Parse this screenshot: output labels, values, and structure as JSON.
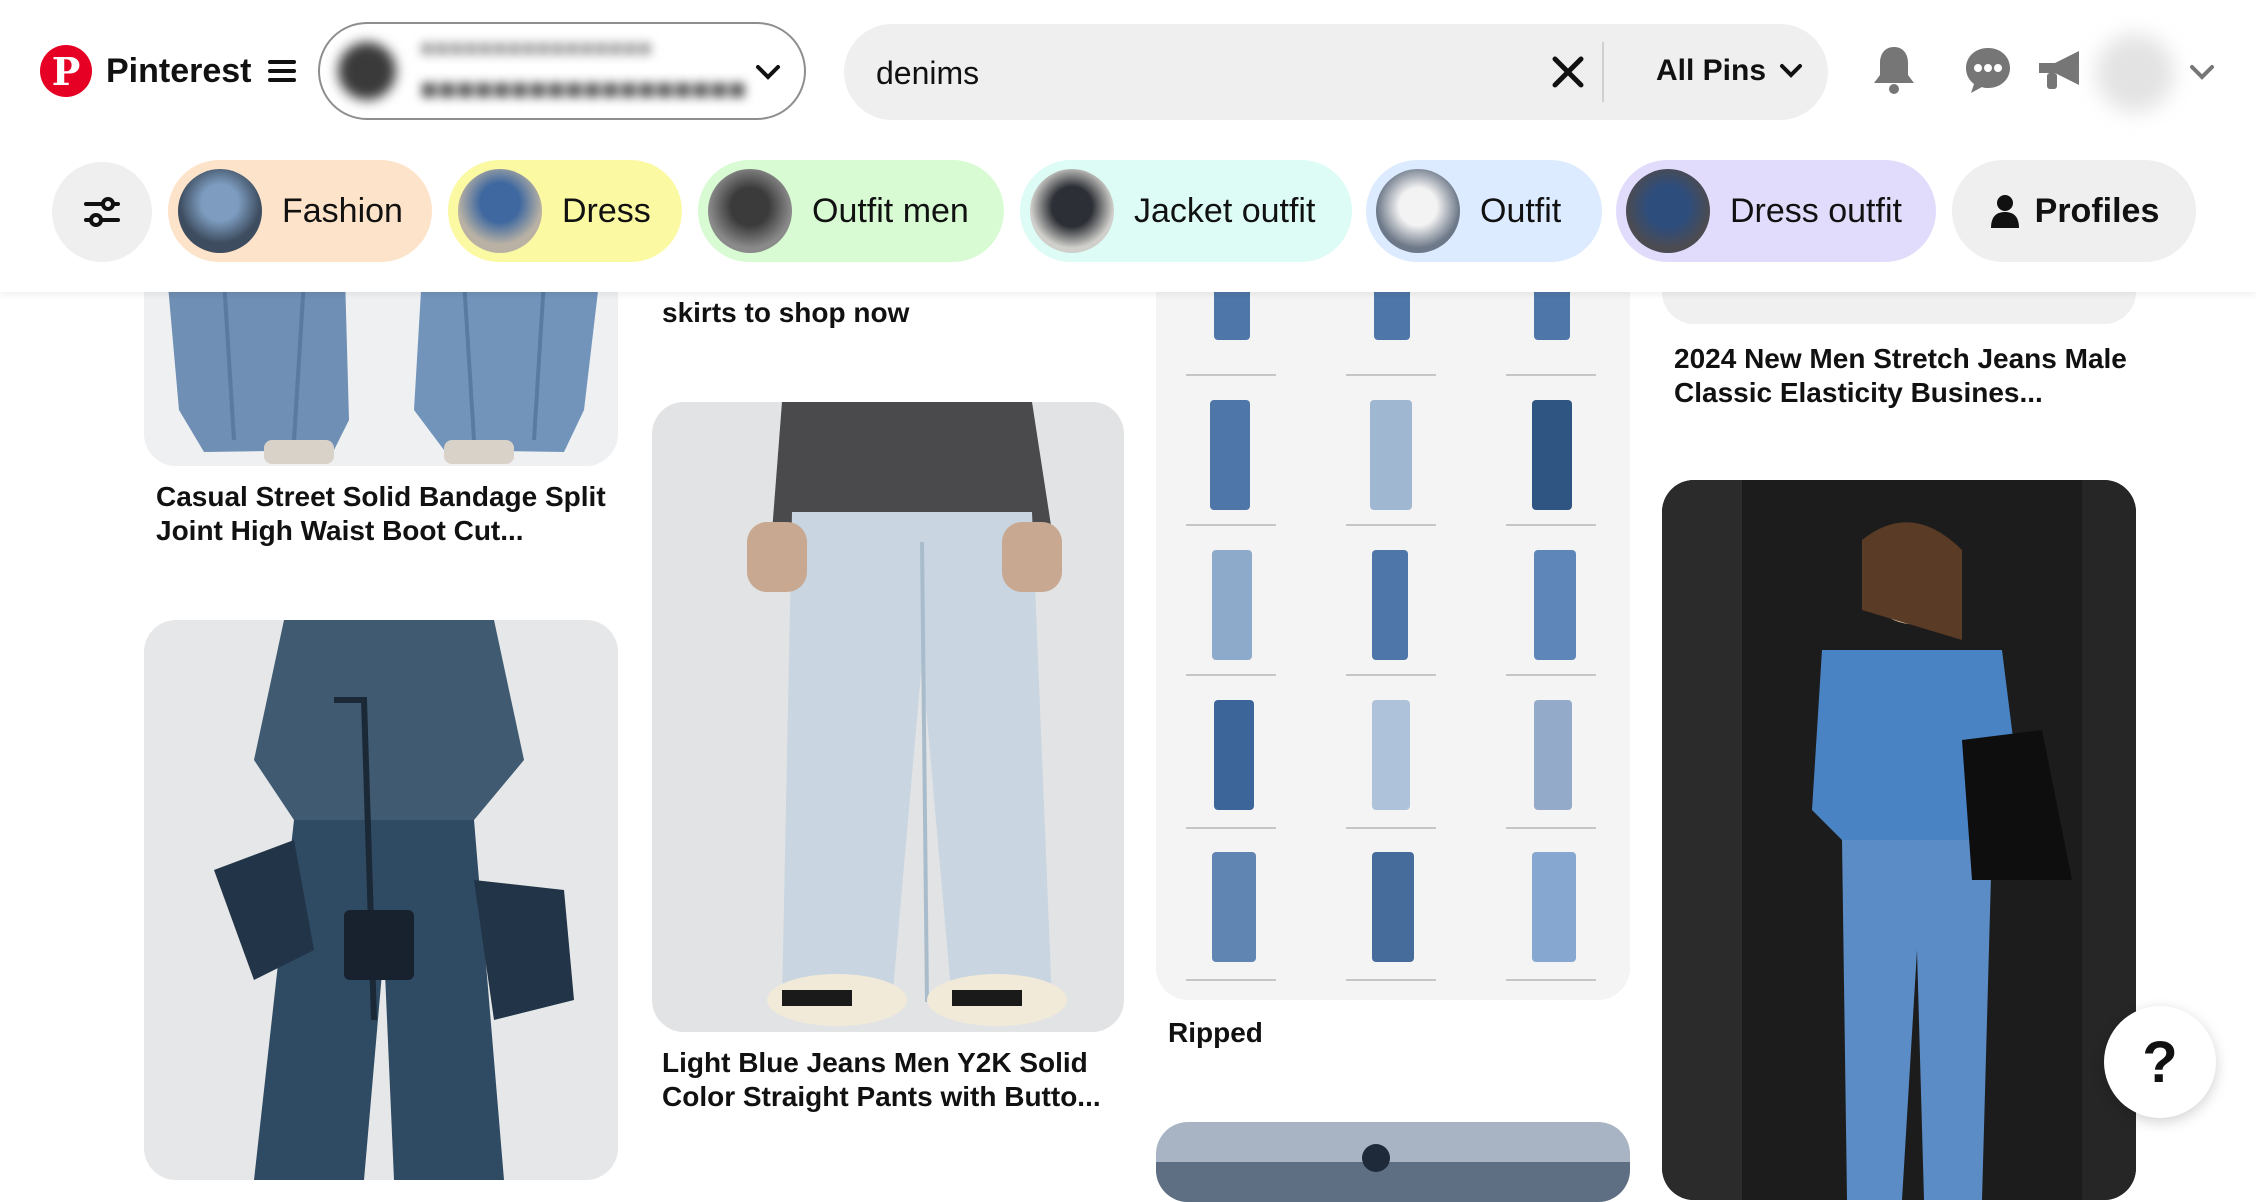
{
  "brand": {
    "name": "Pinterest"
  },
  "search": {
    "value": "denims",
    "scope": "All Pins"
  },
  "chips": [
    {
      "label": "Fashion",
      "color": "#fde3c9"
    },
    {
      "label": "Dress",
      "color": "#fcf9a3"
    },
    {
      "label": "Outfit men",
      "color": "#d8fbd3"
    },
    {
      "label": "Jacket outfit",
      "color": "#dcfcf5"
    },
    {
      "label": "Outfit",
      "color": "#dcebff"
    },
    {
      "label": "Dress outfit",
      "color": "#e2dcfc"
    }
  ],
  "profiles_label": "Profiles",
  "pins": {
    "col1_title": "Casual Street Solid Bandage Split Joint High Waist Boot Cut...",
    "col2_top_title": "skirts to shop now",
    "col2_title": "Light Blue Jeans Men Y2K Solid Color Straight Pants with Butto...",
    "col3_title": "Ripped",
    "col4_title": "2024 New Men Stretch Jeans Male Classic Elasticity Busines..."
  },
  "help_label": "?",
  "colors": {
    "brand_red": "#e60023",
    "chip_bg": "#efefef"
  },
  "icons": [
    "pinterest-logo-icon",
    "menu-icon",
    "chevron-down-icon",
    "clear-icon",
    "bell-icon",
    "chat-icon",
    "megaphone-icon",
    "filters-icon",
    "person-icon"
  ]
}
